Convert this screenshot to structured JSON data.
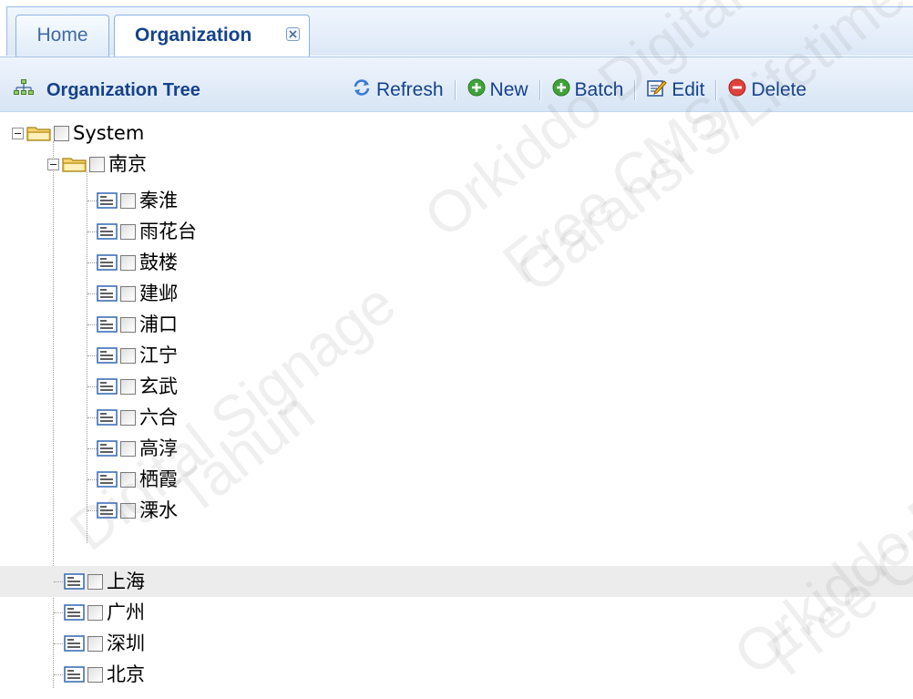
{
  "tabs": [
    {
      "label": "Home",
      "active": false
    },
    {
      "label": "Organization",
      "active": true
    }
  ],
  "panel": {
    "title": "Organization Tree",
    "title_icon": "org-tree-icon"
  },
  "toolbar": {
    "refresh_label": "Refresh",
    "new_label": "New",
    "batch_label": "Batch",
    "edit_label": "Edit",
    "delete_label": "Delete"
  },
  "tree": {
    "root": {
      "label": "System",
      "expanded": true
    },
    "nanjing": {
      "label": "南京",
      "expanded": true
    },
    "nanjing_children": [
      {
        "label": "秦淮"
      },
      {
        "label": "雨花台"
      },
      {
        "label": "鼓楼"
      },
      {
        "label": "建邺"
      },
      {
        "label": "浦口"
      },
      {
        "label": "江宁"
      },
      {
        "label": "玄武"
      },
      {
        "label": "六合"
      },
      {
        "label": "高淳"
      },
      {
        "label": "栖霞"
      },
      {
        "label": "溧水"
      }
    ],
    "siblings": [
      {
        "label": "上海",
        "selected": true
      },
      {
        "label": "广州"
      },
      {
        "label": "深圳"
      },
      {
        "label": "北京"
      }
    ]
  },
  "watermark": [
    "Orkiddo Digital",
    "Garansi 3/Lifetime",
    "Free CMS",
    "Digital Signage",
    "Tahun"
  ],
  "colors": {
    "accent": "#15428b",
    "header_bg": "#dce8f7",
    "selected_row": "#ececec"
  }
}
